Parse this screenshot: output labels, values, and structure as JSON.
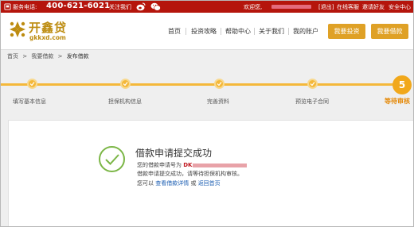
{
  "topbar": {
    "hotline_label": "服务电话:",
    "hotline": "400-621-6021",
    "follow": "关注我们",
    "welcome": "欢迎您,",
    "logout": "[退出]",
    "online_service": "在线客服",
    "invite": "邀请好友",
    "security": "安全中心"
  },
  "header": {
    "logo_cn": "开鑫贷",
    "logo_en": "gkkxd.com",
    "nav": [
      "首页",
      "投资攻略",
      "帮助中心",
      "关于我们",
      "我的账户"
    ],
    "invest_button": "我要投资",
    "borrow_button": "我要借款"
  },
  "breadcrumb": [
    "首页",
    ">",
    "我要借款",
    ">",
    "发布借款"
  ],
  "steps": [
    {
      "label": "填写基本信息",
      "done": true
    },
    {
      "label": "担保机构信息",
      "done": true
    },
    {
      "label": "完善资料",
      "done": true
    },
    {
      "label": "预览电子合同",
      "done": true
    },
    {
      "label": "等待审核",
      "number": "5",
      "active": true
    }
  ],
  "result": {
    "title": "借款申请提交成功",
    "loan_no_prefix": "您的借款申请号为 ",
    "loan_no_code": "DK",
    "waiting_text": "借款申请提交成功，请等待担保机构审核。",
    "you_can": "您可以 ",
    "view_link": "查看借款详情",
    "or": " 或 ",
    "home_link": "返回首页"
  },
  "colors": {
    "topbar_red": "#b5150c",
    "gold": "#dfa126",
    "progress": "#f4b83a",
    "success_green": "#7bb646",
    "link_blue": "#1d5fb3"
  }
}
